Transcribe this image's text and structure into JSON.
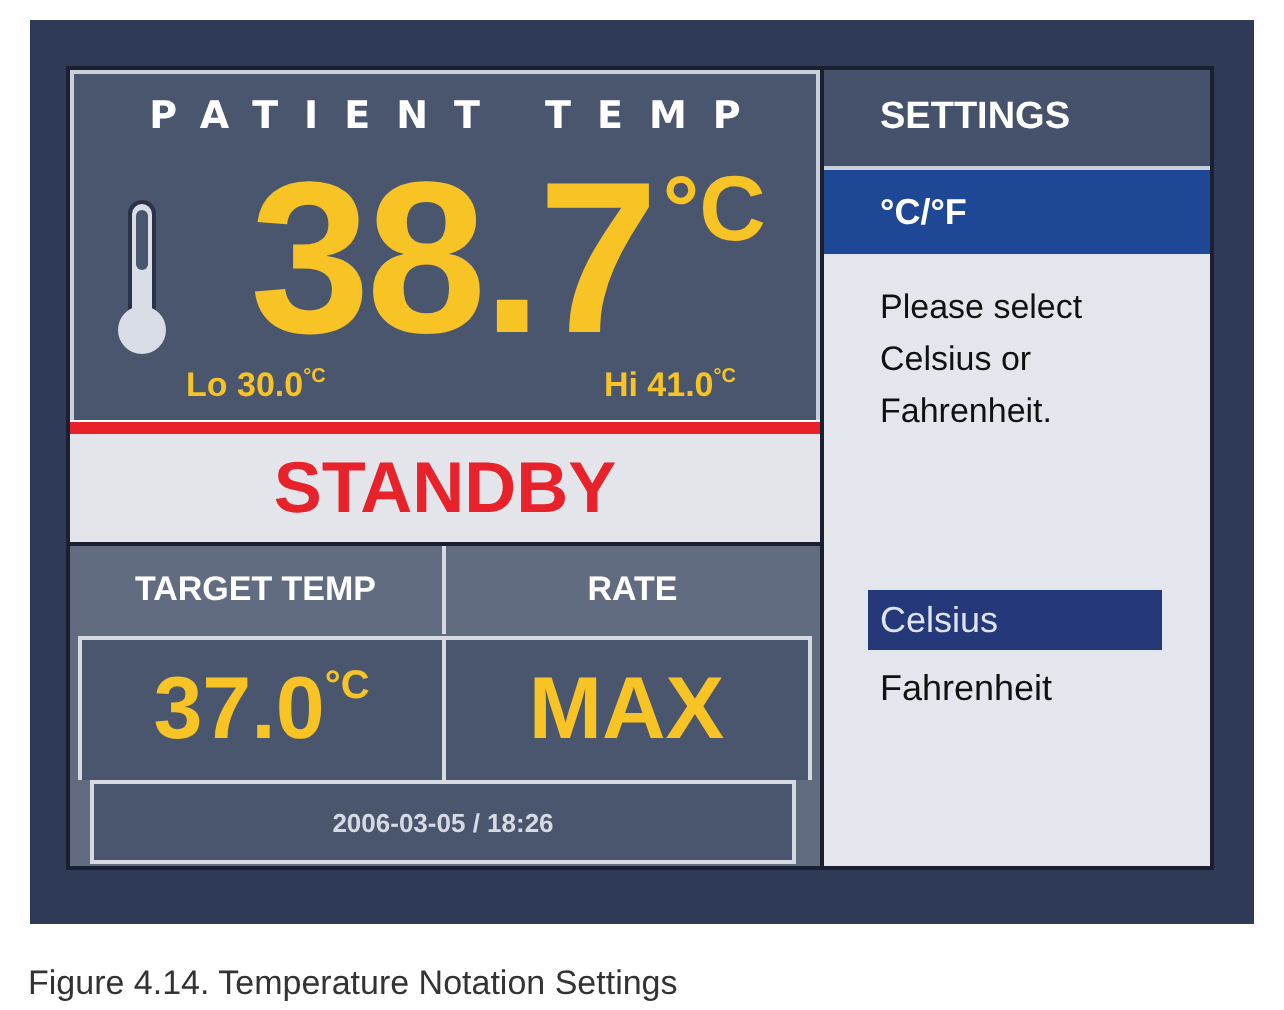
{
  "patient_temp": {
    "label": "PATIENT TEMP",
    "value": "38.7",
    "unit": "°C",
    "lo_label": "Lo",
    "lo": "30.0",
    "lo_unit": "°C",
    "hi_label": "Hi",
    "hi": "41.0",
    "hi_unit": "°C"
  },
  "status": "STANDBY",
  "target": {
    "label": "TARGET TEMP",
    "value": "37.0",
    "unit": "°C"
  },
  "rate": {
    "label": "RATE",
    "value": "MAX"
  },
  "datetime": "2006-03-05 / 18:26",
  "settings": {
    "title": "SETTINGS",
    "item": "°C/°F",
    "prompt": "Please select Celsius or Fahrenheit.",
    "options": [
      {
        "label": "Celsius",
        "selected": true
      },
      {
        "label": "Fahrenheit",
        "selected": false
      }
    ]
  },
  "caption": "Figure 4.14. Temperature Notation Settings"
}
